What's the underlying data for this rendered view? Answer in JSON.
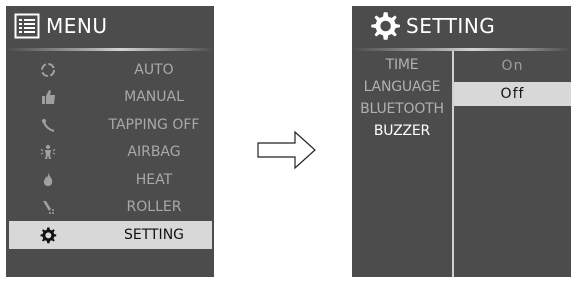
{
  "menu": {
    "title": "MENU",
    "items": [
      {
        "label": "AUTO",
        "icon": "refresh-icon"
      },
      {
        "label": "MANUAL",
        "icon": "thumbs-up-icon"
      },
      {
        "label": "TAPPING OFF",
        "icon": "tapping-icon"
      },
      {
        "label": "AIRBAG",
        "icon": "airbag-icon"
      },
      {
        "label": "HEAT",
        "icon": "flame-icon"
      },
      {
        "label": "ROLLER",
        "icon": "roller-icon"
      },
      {
        "label": "SETTING",
        "icon": "gear-icon"
      }
    ],
    "selected": "SETTING"
  },
  "setting": {
    "title": "SETTING",
    "items": [
      "TIME",
      "LANGUAGE",
      "BLUETOOTH",
      "BUZZER"
    ],
    "active": "BUZZER",
    "options": [
      "On",
      "Off"
    ],
    "selected_option": "Off"
  },
  "colors": {
    "screen_bg": "#4c4c4c",
    "highlight_bg": "#d8d8d8",
    "title_text": "#ffffff"
  }
}
